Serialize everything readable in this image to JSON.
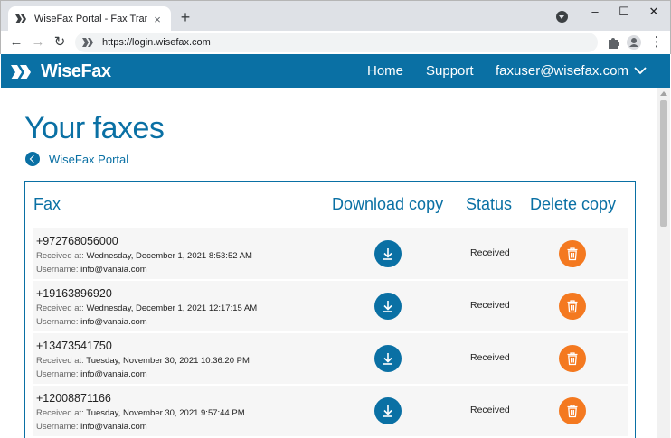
{
  "browser": {
    "tab_title": "WiseFax Portal - Fax Transactions",
    "tab_close": "×",
    "new_tab": "+",
    "url": "https://login.wisefax.com",
    "window_controls": {
      "minimize": "–",
      "maximize": "☐",
      "close": "✕"
    },
    "nav": {
      "back": "←",
      "forward": "→",
      "reload": "↻",
      "menu": "⋮"
    }
  },
  "site": {
    "logo_text": "WiseFax",
    "brand_color": "#0a70a4",
    "accent_color": "#f47920",
    "nav": {
      "home": "Home",
      "support": "Support",
      "user": "faxuser@wisefax.com"
    }
  },
  "page": {
    "title": "Your faxes",
    "back_link": "WiseFax Portal",
    "columns": {
      "fax": "Fax",
      "download": "Download copy",
      "status": "Status",
      "delete": "Delete copy"
    },
    "received_label": "Received at:",
    "username_label": "Username:",
    "rows": [
      {
        "number": "+972768056000",
        "received": "Wednesday, December 1, 2021 8:53:52 AM",
        "username": "info@vanaia.com",
        "status": "Received"
      },
      {
        "number": "+19163896920",
        "received": "Wednesday, December 1, 2021 12:17:15 AM",
        "username": "info@vanaia.com",
        "status": "Received"
      },
      {
        "number": "+13473541750",
        "received": "Tuesday, November 30, 2021 10:36:20 PM",
        "username": "info@vanaia.com",
        "status": "Received"
      },
      {
        "number": "+12008871166",
        "received": "Tuesday, November 30, 2021 9:57:44 PM",
        "username": "info@vanaia.com",
        "status": "Received"
      }
    ]
  }
}
